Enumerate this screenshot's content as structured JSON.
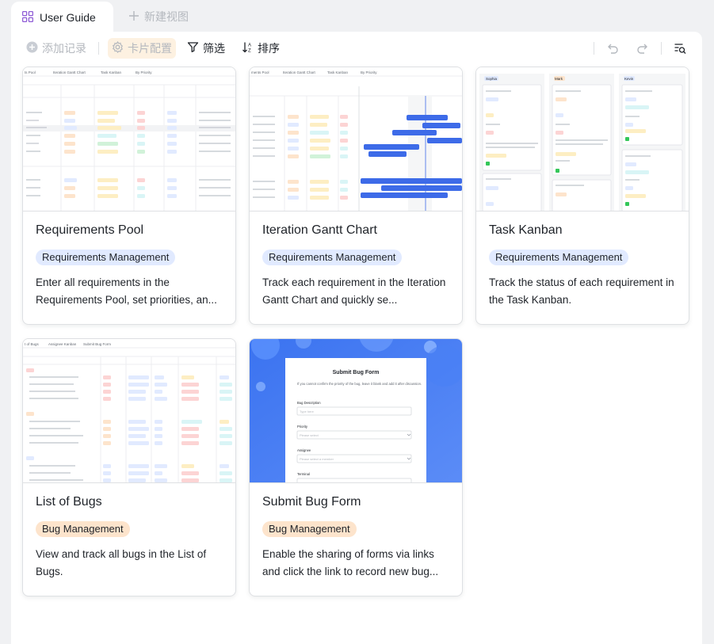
{
  "tabs": {
    "active_label": "User Guide",
    "new_view_label": "新建视图"
  },
  "toolbar": {
    "add_record": "添加记录",
    "card_config": "卡片配置",
    "filter": "筛选",
    "sort": "排序"
  },
  "cards": [
    {
      "title": "Requirements Pool",
      "tag": "Requirements Management",
      "description": "Enter all requirements in the Requirements Pool, set priorities, an...",
      "thumb_tabs": [
        "ts Pool",
        "Iteration Gantt Chart",
        "Task Kanban",
        "By Priority"
      ]
    },
    {
      "title": "Iteration Gantt Chart",
      "tag": "Requirements Management",
      "description": "Track each requirement in the Iteration Gantt Chart and quickly se...",
      "thumb_tabs": [
        "ments Pool",
        "Iteration Gantt Chart",
        "Task Kanban",
        "By Priority"
      ]
    },
    {
      "title": "Task Kanban",
      "tag": "Requirements Management",
      "description": "Track the status of each requirement in the Task Kanban.",
      "thumb_columns": [
        "Sophia",
        "Mark",
        "Kevin"
      ]
    },
    {
      "title": "List of Bugs",
      "tag": "Bug Management",
      "description": "View and track all bugs in the List of Bugs.",
      "thumb_tabs": [
        "t of Bugs",
        "Assignee Kanban",
        "Submit Bug Form"
      ]
    },
    {
      "title": "Submit Bug Form",
      "tag": "Bug Management",
      "description": "Enable the sharing of forms via links and click the link to record new bug...",
      "form_title": "Submit Bug Form",
      "form_intro": "If you cannot confirm the priority of the bug, leave it blank and add it after discussion.",
      "form_fields": [
        "Bug Description",
        "Priority",
        "Assignee",
        "Terminal"
      ],
      "form_placeholders": [
        "Type here",
        "Please select",
        "Please select a member"
      ]
    }
  ],
  "colors": {
    "requirements_tag_bg": "#e1eaff",
    "requirements_tag_fg": "#1f2329",
    "bug_tag_bg": "#fde4cc",
    "bug_tag_fg": "#1f2329",
    "accent_blue": "#3d6be8",
    "card_config_bg": "#fdf1e1"
  },
  "icons": {
    "active_tab": "grid-icon",
    "new_view": "plus-icon",
    "add_record": "plus-circle-icon",
    "card_config": "gear-icon",
    "filter": "filter-icon",
    "sort": "sort-icon",
    "undo": "undo-icon",
    "redo": "redo-icon",
    "search": "search-list-icon"
  }
}
